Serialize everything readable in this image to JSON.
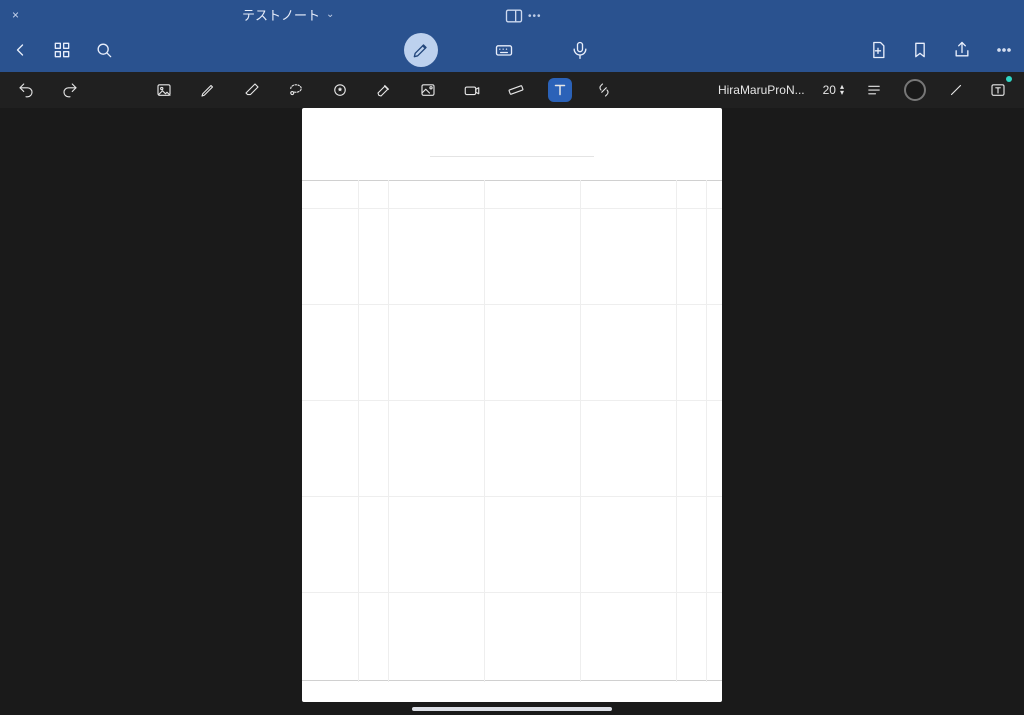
{
  "header": {
    "document_title": "テストノート",
    "close_label": "×"
  },
  "toolbar": {
    "font_name": "HiraMaruProN...",
    "font_size": "20"
  },
  "icons": {
    "back": "back-icon",
    "grid": "grid-icon",
    "search": "search-icon",
    "pen_mode": "pen-mode-icon",
    "keyboard": "keyboard-icon",
    "mic": "mic-icon",
    "add_page": "add-page-icon",
    "bookmark": "bookmark-icon",
    "share": "share-icon",
    "more": "more-icon",
    "undo": "undo-icon",
    "redo": "redo-icon",
    "image_ai": "image-insert-icon",
    "pen": "pen-icon",
    "eraser": "eraser-icon",
    "lasso": "lasso-icon",
    "shape": "shape-icon",
    "highlighter": "highlighter-icon",
    "photo": "photo-icon",
    "camera": "camera-icon",
    "ruler": "ruler-icon",
    "text": "text-icon",
    "link": "link-icon",
    "align": "align-icon",
    "line": "line-icon",
    "textbox": "textbox-icon"
  }
}
